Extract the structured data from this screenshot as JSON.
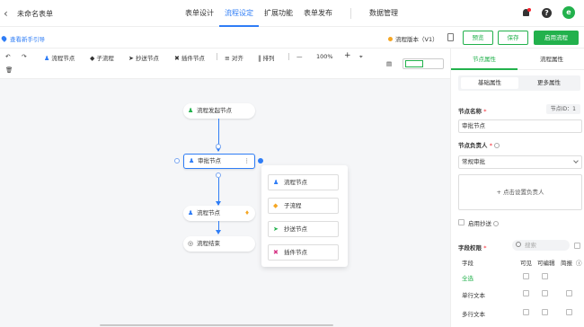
{
  "topbar": {
    "back_icon": "back-chevron-icon",
    "form_title": "未命名表单",
    "tabs": [
      "表单设计",
      "流程设定",
      "扩展功能",
      "表单发布",
      "数据管理"
    ],
    "active_tab": 1,
    "avatar_letter": "e"
  },
  "subbar": {
    "guide_label": "查看新手引导",
    "version_label": "流程版本（V1）",
    "preview_label": "预览",
    "save_label": "保存",
    "enable_label": "启用流程"
  },
  "toolbar": {
    "approval_node": "流程节点",
    "subflow": "子流程",
    "cc_node": "抄送节点",
    "plugin_node": "插件节点",
    "align": "对齐",
    "arrange": "排列",
    "zoom_minus": "—",
    "zoom": "100%",
    "zoom_plus": "+"
  },
  "flow": {
    "start_node": "流程发起节点",
    "approve_node": "审批节点",
    "process_node": "流程节点",
    "end_node": "流程结束",
    "popup_items": [
      "流程节点",
      "子流程",
      "抄送节点",
      "插件节点"
    ]
  },
  "panel": {
    "tabs": [
      "节点属性",
      "流程属性"
    ],
    "seg_basic": "基础属性",
    "seg_more": "更多属性",
    "node_name_label": "节点名称",
    "node_id": "节点ID：1",
    "node_name_value": "审批节点",
    "owner_label": "节点负责人",
    "owner_value": "常规审批",
    "add_owner": "+ 点击设置负责人",
    "enable_cc": "启用抄送",
    "field_perm_label": "字段权限",
    "search_placeholder": "搜索",
    "col_field": "字段",
    "col_visible": "可见",
    "col_editable": "可编辑",
    "col_required": "简报",
    "rows": [
      "全选",
      "单行文本",
      "多行文本"
    ]
  },
  "colors": {
    "primary_green": "#22b14c",
    "primary_blue": "#2f7df6"
  }
}
